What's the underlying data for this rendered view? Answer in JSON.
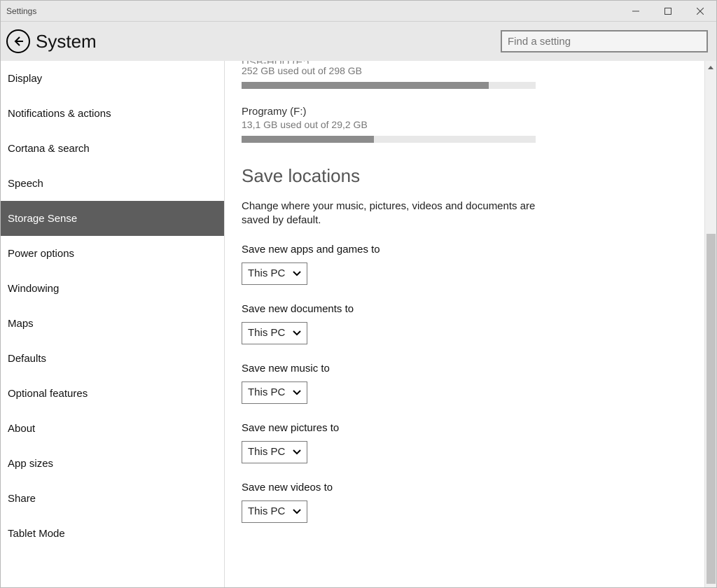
{
  "window": {
    "title": "Settings"
  },
  "header": {
    "section": "System",
    "search_placeholder": "Find a setting"
  },
  "sidebar": {
    "active_index": 4,
    "items": [
      {
        "label": "Display"
      },
      {
        "label": "Notifications & actions"
      },
      {
        "label": "Cortana & search"
      },
      {
        "label": "Speech"
      },
      {
        "label": "Storage Sense"
      },
      {
        "label": "Power options"
      },
      {
        "label": "Windowing"
      },
      {
        "label": "Maps"
      },
      {
        "label": "Defaults"
      },
      {
        "label": "Optional features"
      },
      {
        "label": "About"
      },
      {
        "label": "App sizes"
      },
      {
        "label": "Share"
      },
      {
        "label": "Tablet Mode"
      }
    ]
  },
  "storage": {
    "drives": [
      {
        "name": "USB-HDD (E:)",
        "subtitle": "252 GB used out of 298 GB",
        "fill_pct": 84
      },
      {
        "name": "Programy (F:)",
        "subtitle": "13,1 GB used out of 29,2 GB",
        "fill_pct": 45
      }
    ]
  },
  "save_locations": {
    "heading": "Save locations",
    "description": "Change where your music, pictures, videos and documents are saved by default.",
    "items": [
      {
        "label": "Save new apps and games to",
        "value": "This PC"
      },
      {
        "label": "Save new documents to",
        "value": "This PC"
      },
      {
        "label": "Save new music to",
        "value": "This PC"
      },
      {
        "label": "Save new pictures to",
        "value": "This PC"
      },
      {
        "label": "Save new videos to",
        "value": "This PC"
      }
    ]
  }
}
